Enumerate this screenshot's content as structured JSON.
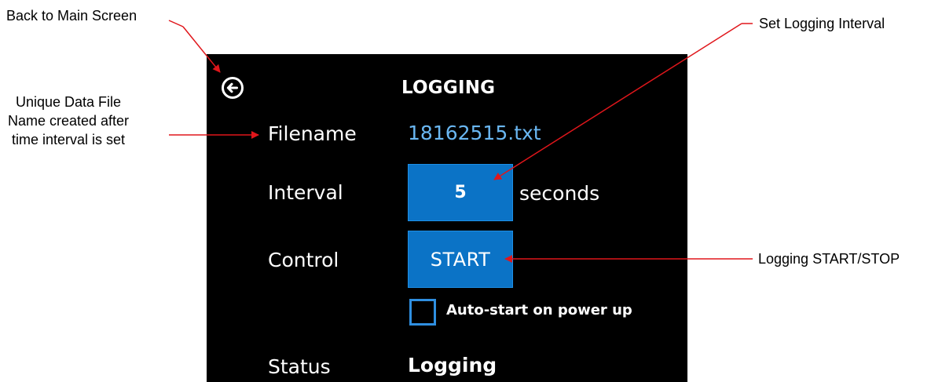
{
  "annotations": {
    "back": "Back to Main Screen",
    "filename_line1": "Unique Data File",
    "filename_line2": "Name created after",
    "filename_line3": "time interval is set",
    "interval": "Set Logging Interval",
    "logging": "Logging START/STOP"
  },
  "screen": {
    "title": "LOGGING",
    "back_icon": "arrow-left-circle-icon",
    "filename_label": "Filename",
    "filename_value": "18162515.txt",
    "interval_label": "Interval",
    "interval_value": "5",
    "interval_unit": "seconds",
    "control_label": "Control",
    "control_button": "START",
    "autostart_label": "Auto-start on power up",
    "autostart_checked": false,
    "status_label": "Status",
    "status_value": "Logging"
  },
  "colors": {
    "screen_background": "#000000",
    "button_blue": "#0b73c6",
    "filename_blue": "#6ab7f2",
    "annotation_arrow": "#e0161b"
  }
}
